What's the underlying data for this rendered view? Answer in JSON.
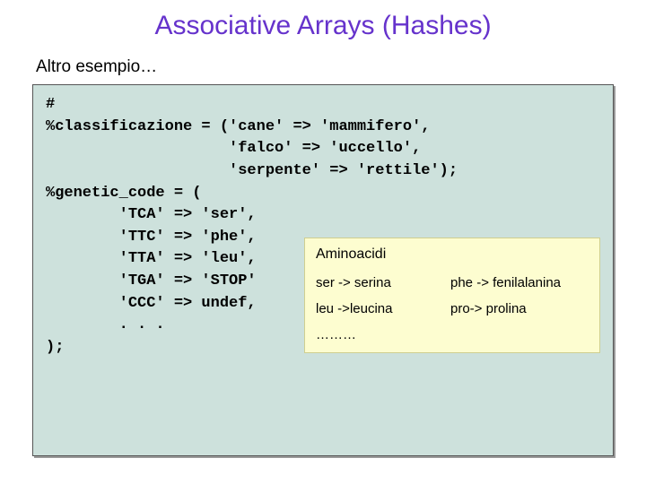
{
  "title": "Associative Arrays (Hashes)",
  "subtitle": "Altro esempio…",
  "code": {
    "l01": "#",
    "l02": "",
    "l03": "%classificazione = ('cane' => 'mammifero',",
    "l04": "                    'falco' => 'uccello',",
    "l05": "                    'serpente' => 'rettile');",
    "l06": "",
    "l07": "%genetic_code = (",
    "l08": "",
    "l09": "        'TCA' => 'ser',",
    "l10": "",
    "l11": "        'TTC' => 'phe',",
    "l12": "",
    "l13": "        'TTA' => 'leu',",
    "l14": "",
    "l15": "        'TGA' => 'STOP'",
    "l16": "",
    "l17": "        'CCC' => undef,",
    "l18": "",
    "l19": "        . . .",
    "l20": ");"
  },
  "legend": {
    "title": "Aminoacidi",
    "rows": [
      {
        "c1": "ser ->   serina",
        "c2": "phe -> fenilalanina"
      },
      {
        "c1": "leu ->leucina",
        "c2": "pro->   prolina"
      },
      {
        "c1": "………",
        "c2": ""
      }
    ]
  }
}
